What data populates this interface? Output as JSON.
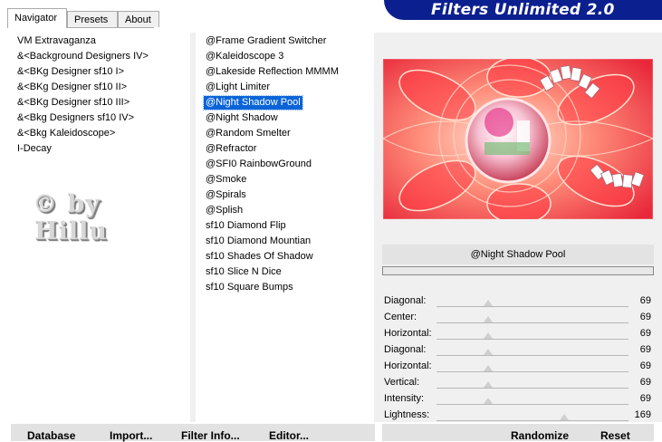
{
  "tabs": {
    "navigator": "Navigator",
    "presets": "Presets",
    "about": "About"
  },
  "banner": {
    "title": "Filters Unlimited 2.0"
  },
  "categories": [
    "VM Extravaganza",
    "&<Background Designers IV>",
    "&<BKg Designer sf10 I>",
    "&<BKg Designer sf10 II>",
    "&<BKg Designer sf10 III>",
    "&<Bkg Designers sf10 IV>",
    "&<Bkg Kaleidoscope>",
    "I-Decay"
  ],
  "filters": [
    "@Frame Gradient Switcher",
    "@Kaleidoscope 3",
    "@Lakeside Reflection MMMM",
    "@Light Limiter",
    "@Night Shadow Pool",
    "@Night Shadow",
    "@Random Smelter",
    "@Refractor",
    "@SFI0 RainbowGround",
    "@Smoke",
    "@Spirals",
    "@Splish",
    "sf10 Diamond Flip",
    "sf10 Diamond Mountian",
    "sf10 Shades Of Shadow",
    "sf10 Slice N Dice",
    "sf10 Square Bumps"
  ],
  "selected_filter": "@Night Shadow Pool",
  "watermark": {
    "line1": "© by",
    "line2": "Hillu"
  },
  "filter_name": "@Night Shadow Pool",
  "progress": 0,
  "params": [
    {
      "label": "Diagonal:",
      "value": 69
    },
    {
      "label": "Center:",
      "value": 69
    },
    {
      "label": "Horizontal:",
      "value": 69
    },
    {
      "label": "Diagonal:",
      "value": 69
    },
    {
      "label": "Horizontal:",
      "value": 69
    },
    {
      "label": "Vertical:",
      "value": 69
    },
    {
      "label": "Intensity:",
      "value": 69
    },
    {
      "label": "Lightness:",
      "value": 169
    }
  ],
  "buttons": {
    "database": "Database",
    "import": "Import...",
    "filter_info": "Filter Info...",
    "editor": "Editor...",
    "randomize": "Randomize",
    "reset": "Reset"
  }
}
